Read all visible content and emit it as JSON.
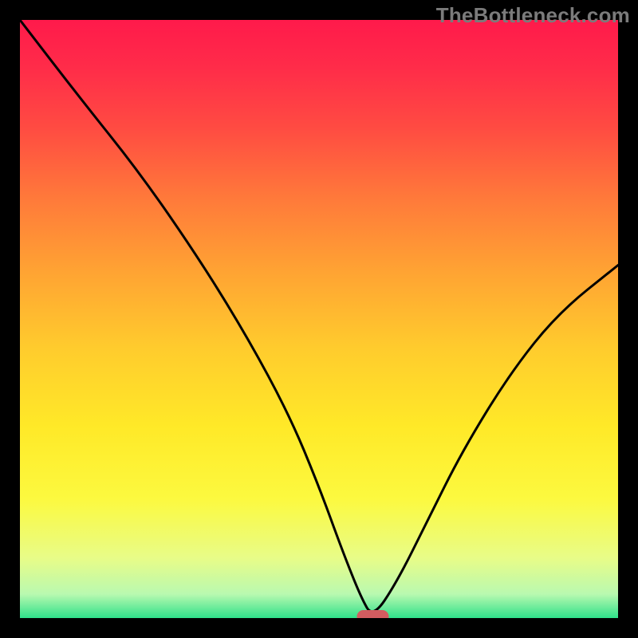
{
  "watermark": "TheBottleneck.com",
  "chart_data": {
    "type": "line",
    "title": "",
    "xlabel": "",
    "ylabel": "",
    "xlim": [
      0,
      1000
    ],
    "ylim": [
      0,
      1000
    ],
    "series": [
      {
        "name": "curve",
        "x": [
          0,
          100,
          200,
          300,
          380,
          450,
          500,
          540,
          570,
          590,
          630,
          680,
          740,
          820,
          900,
          1000
        ],
        "values": [
          1000,
          870,
          745,
          600,
          470,
          340,
          220,
          110,
          35,
          0,
          60,
          160,
          280,
          410,
          510,
          590
        ]
      }
    ],
    "marker": {
      "x": 590,
      "y": 0,
      "color": "#d35c60"
    },
    "gradient_stops": [
      {
        "offset": 0.0,
        "color": "#ff1a4b"
      },
      {
        "offset": 0.08,
        "color": "#ff2c49"
      },
      {
        "offset": 0.18,
        "color": "#ff4b42"
      },
      {
        "offset": 0.3,
        "color": "#ff7a3a"
      },
      {
        "offset": 0.42,
        "color": "#ffa333"
      },
      {
        "offset": 0.55,
        "color": "#ffcc2d"
      },
      {
        "offset": 0.68,
        "color": "#ffe928"
      },
      {
        "offset": 0.8,
        "color": "#fcf93f"
      },
      {
        "offset": 0.9,
        "color": "#e8fc88"
      },
      {
        "offset": 0.96,
        "color": "#b9f9b0"
      },
      {
        "offset": 1.0,
        "color": "#2fe18a"
      }
    ]
  }
}
